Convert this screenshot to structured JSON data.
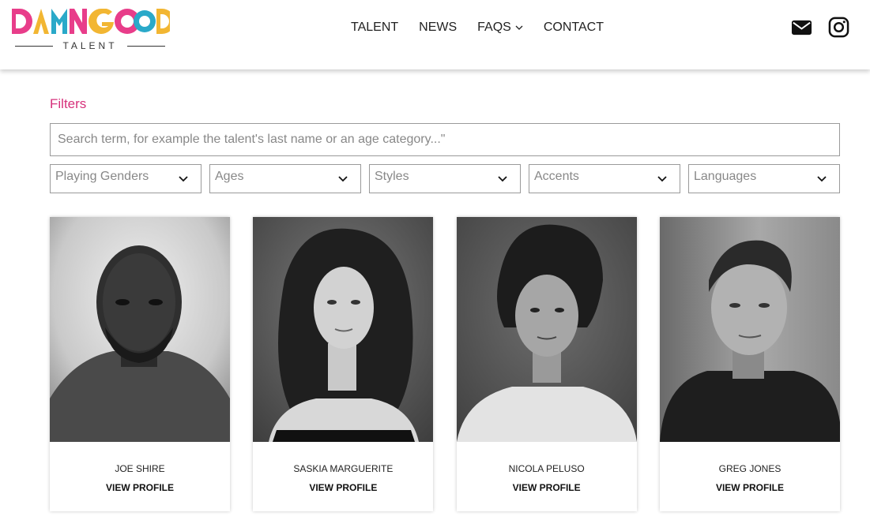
{
  "brand": {
    "logo_letters": [
      "D",
      "A",
      "M",
      "N",
      "G",
      "O",
      "O",
      "D"
    ],
    "logo_colors": [
      "#e83d8a",
      "#f2b632",
      "#2aa9c9",
      "#e83d8a",
      "#f2b632",
      "#e83d8a",
      "#2aa9c9",
      "#f2b632"
    ],
    "logo_sub": "TALENT"
  },
  "nav": {
    "items": [
      {
        "label": "TALENT"
      },
      {
        "label": "NEWS"
      },
      {
        "label": "FAQS"
      },
      {
        "label": "CONTACT"
      }
    ]
  },
  "header_icons": [
    "envelope-icon",
    "instagram-icon"
  ],
  "filters": {
    "title": "Filters",
    "search_placeholder": "Search term, for example the talent's last name or an age category...\"",
    "selects": [
      {
        "label": "Playing Genders"
      },
      {
        "label": "Ages"
      },
      {
        "label": "Styles"
      },
      {
        "label": "Accents"
      },
      {
        "label": "Languages"
      }
    ]
  },
  "talent": [
    {
      "name": "JOE SHIRE",
      "link": "VIEW PROFILE"
    },
    {
      "name": "SASKIA MARGUERITE",
      "link": "VIEW PROFILE"
    },
    {
      "name": "NICOLA PELUSO",
      "link": "VIEW PROFILE"
    },
    {
      "name": "GREG JONES",
      "link": "VIEW PROFILE"
    }
  ],
  "colors": {
    "accent": "#d6317b",
    "border": "#9a9a9a"
  }
}
